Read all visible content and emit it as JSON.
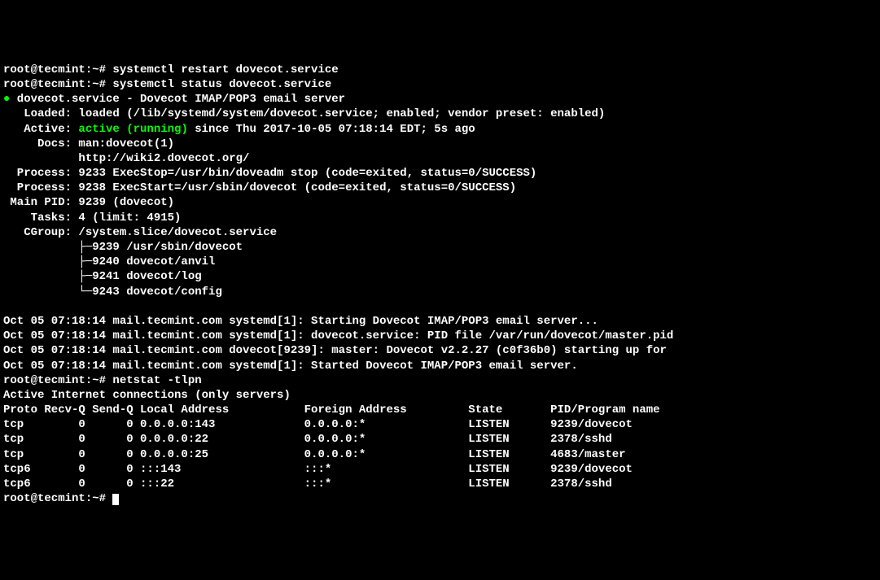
{
  "prompts": {
    "p1": "root@tecmint:~# ",
    "p2": "root@tecmint:~# ",
    "p3": "root@tecmint:~# ",
    "p4": "root@tecmint:~# "
  },
  "commands": {
    "restart": "systemctl restart dovecot.service",
    "status": "systemctl status dovecot.service",
    "netstat": "netstat -tlpn"
  },
  "status": {
    "bullet": "●",
    "title": " dovecot.service - Dovecot IMAP/POP3 email server",
    "loaded": "   Loaded: loaded (/lib/systemd/system/dovecot.service; enabled; vendor preset: enabled)",
    "active_label": "   Active: ",
    "active_value": "active (running)",
    "active_rest": " since Thu 2017-10-05 07:18:14 EDT; 5s ago",
    "docs1": "     Docs: man:dovecot(1)",
    "docs2": "           http://wiki2.dovecot.org/",
    "process1": "  Process: 9233 ExecStop=/usr/bin/doveadm stop (code=exited, status=0/SUCCESS)",
    "process2": "  Process: 9238 ExecStart=/usr/sbin/dovecot (code=exited, status=0/SUCCESS)",
    "mainpid": " Main PID: 9239 (dovecot)",
    "tasks": "    Tasks: 4 (limit: 4915)",
    "cgroup": "   CGroup: /system.slice/dovecot.service",
    "cg1": "           ├─9239 /usr/sbin/dovecot",
    "cg2": "           ├─9240 dovecot/anvil",
    "cg3": "           ├─9241 dovecot/log",
    "cg4": "           └─9243 dovecot/config"
  },
  "logs": {
    "l1": "Oct 05 07:18:14 mail.tecmint.com systemd[1]: Starting Dovecot IMAP/POP3 email server...",
    "l2": "Oct 05 07:18:14 mail.tecmint.com systemd[1]: dovecot.service: PID file /var/run/dovecot/master.pid",
    "l3": "Oct 05 07:18:14 mail.tecmint.com dovecot[9239]: master: Dovecot v2.2.27 (c0f36b0) starting up for",
    "l4": "Oct 05 07:18:14 mail.tecmint.com systemd[1]: Started Dovecot IMAP/POP3 email server."
  },
  "netheader": "Active Internet connections (only servers)",
  "netcols": "Proto Recv-Q Send-Q Local Address           Foreign Address         State       PID/Program name",
  "netrows": {
    "r1": "tcp        0      0 0.0.0.0:143             0.0.0.0:*               LISTEN      9239/dovecot",
    "r2": "tcp        0      0 0.0.0.0:22              0.0.0.0:*               LISTEN      2378/sshd",
    "r3": "tcp        0      0 0.0.0.0:25              0.0.0.0:*               LISTEN      4683/master",
    "r4": "tcp6       0      0 :::143                  :::*                    LISTEN      9239/dovecot",
    "r5": "tcp6       0      0 :::22                   :::*                    LISTEN      2378/sshd"
  }
}
